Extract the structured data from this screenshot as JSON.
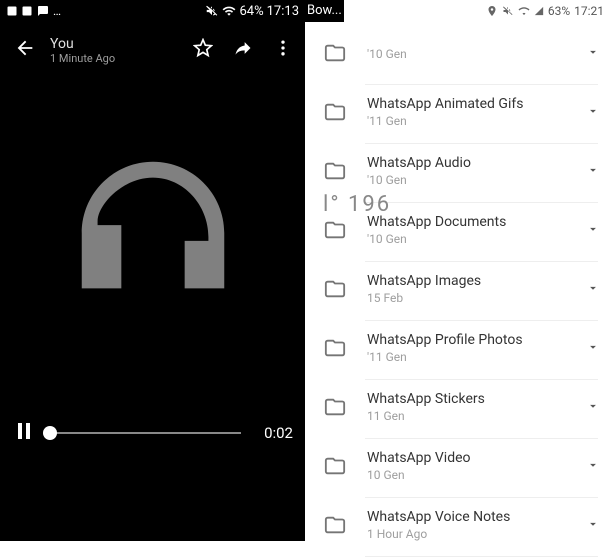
{
  "left": {
    "status": {
      "battery": "64%",
      "time": "17:13"
    },
    "header": {
      "title": "You",
      "subtitle": "1 Minute Ago"
    },
    "player": {
      "time": "0:02"
    },
    "icons": {
      "back": "back-arrow-icon",
      "star": "star-icon",
      "share": "share-icon",
      "more": "more-vert-icon",
      "pause": "pause-icon",
      "art": "headphones-icon"
    }
  },
  "right": {
    "status": {
      "battery": "63%",
      "time": "17:21",
      "overflow": "Bow..."
    },
    "overlay": "l° 196",
    "folders": [
      {
        "name": "",
        "sub": "'10 Gen"
      },
      {
        "name": "WhatsApp Animated Gifs",
        "sub": "'11 Gen"
      },
      {
        "name": "WhatsApp Audio",
        "sub": "'10 Gen"
      },
      {
        "name": "WhatsApp Documents",
        "sub": "'10 Gen"
      },
      {
        "name": "WhatsApp Images",
        "sub": "15 Feb"
      },
      {
        "name": "WhatsApp Profile Photos",
        "sub": "'11 Gen"
      },
      {
        "name": "WhatsApp Stickers",
        "sub": "11 Gen"
      },
      {
        "name": "WhatsApp Video",
        "sub": "10 Gen"
      },
      {
        "name": "WhatsApp Voice Notes",
        "sub": "1 Hour Ago"
      }
    ]
  }
}
